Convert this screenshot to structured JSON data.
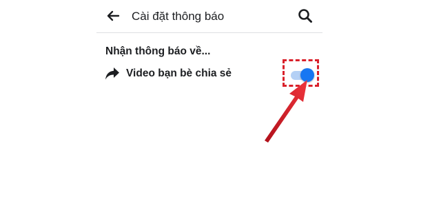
{
  "header": {
    "title": "Cài đặt thông báo",
    "back_icon": "arrow-left",
    "search_icon": "magnifier"
  },
  "section": {
    "heading": "Nhận thông báo về...",
    "items": [
      {
        "icon": "share-arrow",
        "label": "Video bạn bè chia sẻ",
        "toggle_on": true
      }
    ]
  },
  "colors": {
    "accent": "#1877f2",
    "toggle_track": "#b4d0f5",
    "highlight": "#d9202a",
    "text": "#1c1e21",
    "divider": "#dddfe2"
  }
}
